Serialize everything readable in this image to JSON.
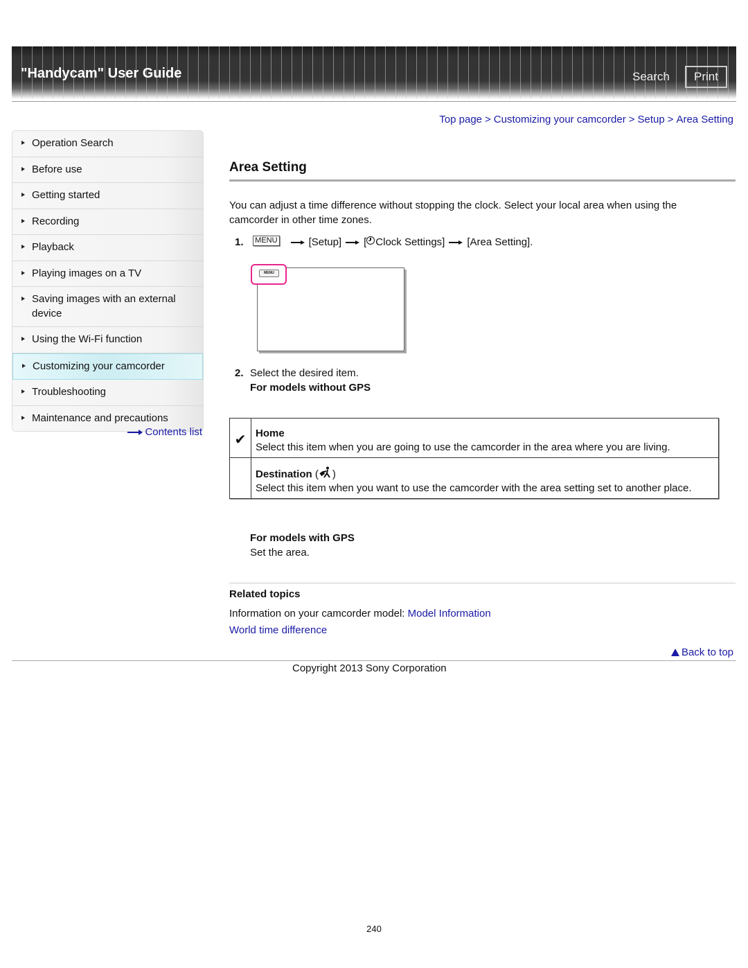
{
  "header": {
    "title": "\"Handycam\" User Guide",
    "search_label": "Search",
    "print_label": "Print"
  },
  "breadcrumb": {
    "items": [
      "Top page",
      "Customizing your camcorder",
      "Setup",
      "Area Setting"
    ],
    "separator": ">"
  },
  "sidebar": {
    "items": [
      {
        "label": "Operation Search",
        "active": false
      },
      {
        "label": "Before use",
        "active": false
      },
      {
        "label": "Getting started",
        "active": false
      },
      {
        "label": "Recording",
        "active": false
      },
      {
        "label": "Playback",
        "active": false
      },
      {
        "label": "Playing images on a TV",
        "active": false
      },
      {
        "label": "Saving images with an external device",
        "active": false
      },
      {
        "label": "Using the Wi-Fi function",
        "active": false
      },
      {
        "label": "Customizing your camcorder",
        "active": true
      },
      {
        "label": "Troubleshooting",
        "active": false
      },
      {
        "label": "Maintenance and precautions",
        "active": false
      }
    ],
    "contents_link": "Contents list"
  },
  "main": {
    "title": "Area Setting",
    "intro": "You can adjust a time difference without stopping the clock. Select your local area when using the camcorder in other time zones.",
    "step1": {
      "num": "1.",
      "menu_button": "MENU",
      "path1": "[Setup]",
      "path2_open": "[",
      "path2": "Clock Settings]",
      "path3": "[Area Setting].",
      "illustration_button": "MENU"
    },
    "step2": {
      "num": "2.",
      "text": "Select the desired item.",
      "subheading": "For models without GPS"
    },
    "options": [
      {
        "checked": true,
        "check_glyph": "✔",
        "name": "Home",
        "desc": "Select this item when you are going to use the camcorder in the area where you are living."
      },
      {
        "checked": false,
        "check_glyph": "",
        "name": "Destination",
        "name_suffix_open": "(",
        "name_suffix_close": ")",
        "desc": "Select this item when you want to use the camcorder with the area setting set to another place."
      }
    ],
    "gps": {
      "title": "For models with GPS",
      "text": "Set the area."
    },
    "related": {
      "title": "Related topics",
      "line1_prefix": "Information on your camcorder model: ",
      "line1_link": "Model Information",
      "line2_link": "World time difference"
    }
  },
  "footer": {
    "back_to_top": "Back to top",
    "copyright": "Copyright 2013 Sony Corporation",
    "page_number": "240"
  },
  "colors": {
    "link": "#1a1aa6",
    "highlight": "#e8248c",
    "active_nav": "#cdeef3"
  }
}
